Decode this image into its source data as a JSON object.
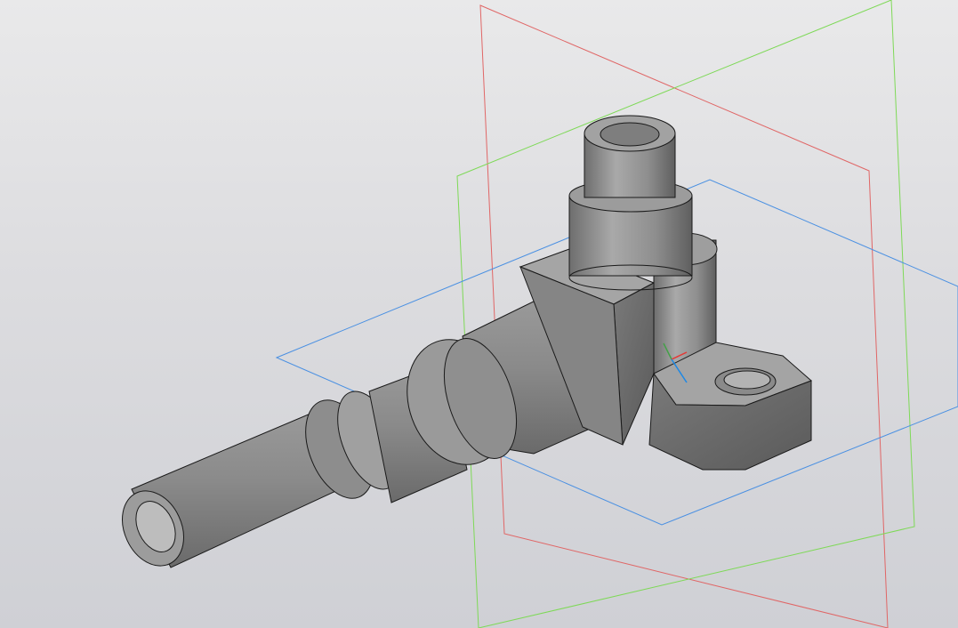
{
  "viewport": {
    "background": [
      "#e9e9ea",
      "#cfd0d5"
    ],
    "model_color": "#8c8c8c",
    "edge_color": "#1a1a1a"
  },
  "planes": [
    {
      "name": "plane-front",
      "color": "#e06666"
    },
    {
      "name": "plane-right",
      "color": "#7ed957"
    },
    {
      "name": "plane-top",
      "color": "#4a90e2"
    }
  ],
  "triad": {
    "x_color": "#e53935",
    "y_color": "#43a047",
    "z_color": "#1e88e5"
  }
}
